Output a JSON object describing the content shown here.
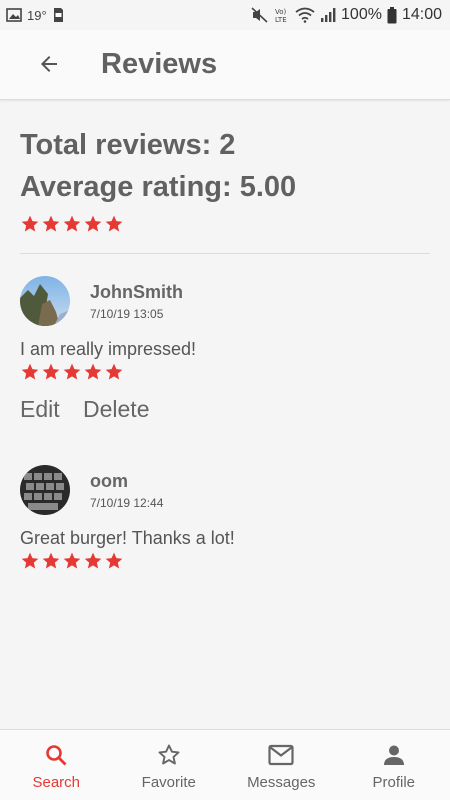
{
  "status_bar": {
    "temperature": "19°",
    "battery": "100%",
    "time": "14:00",
    "volte_label": "Vo) LTE"
  },
  "app_bar": {
    "title": "Reviews"
  },
  "summary": {
    "total_reviews": "Total reviews: 2",
    "average_rating": "Average rating: 5.00",
    "stars": 5
  },
  "reviews": [
    {
      "name": "JohnSmith",
      "date": "7/10/19 13:05",
      "text": "I am really impressed!",
      "stars": 5,
      "actions": {
        "edit": "Edit",
        "delete": "Delete"
      }
    },
    {
      "name": "oom",
      "date": "7/10/19 12:44",
      "text": "Great burger! Thanks a lot!",
      "stars": 5
    }
  ],
  "bottom_nav": {
    "items": [
      {
        "label": "Search",
        "icon": "search-icon",
        "active": true
      },
      {
        "label": "Favorite",
        "icon": "star-outline-icon",
        "active": false
      },
      {
        "label": "Messages",
        "icon": "mail-icon",
        "active": false
      },
      {
        "label": "Profile",
        "icon": "person-icon",
        "active": false
      }
    ]
  },
  "colors": {
    "accent": "#e53935",
    "text": "#616161",
    "background": "#f5f5f5"
  }
}
